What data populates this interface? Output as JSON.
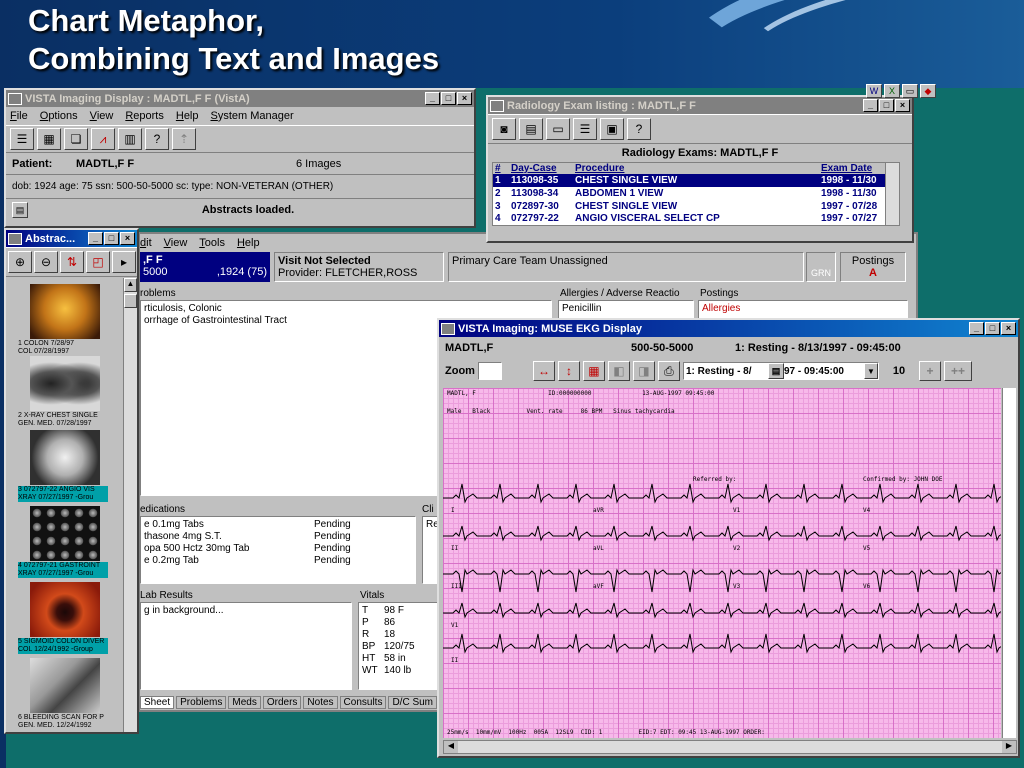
{
  "slide": {
    "title_line1": "Chart Metaphor,",
    "title_line2": "Combining Text and Images"
  },
  "vista_display": {
    "title": "VISTA Imaging Display : MADTL,F F (VistA)",
    "menu": [
      "File",
      "Options",
      "View",
      "Reports",
      "Help",
      "System Manager"
    ],
    "patient_label": "Patient:",
    "patient_name": "MADTL,F F",
    "image_count": "6 Images",
    "demographics": "dob: 1924   age: 75   ssn: 500-50-5000   sc:     type: NON-VETERAN (OTHER)",
    "status": "Abstracts loaded."
  },
  "radiology": {
    "title": "Radiology Exam listing  : MADTL,F F",
    "heading": "Radiology Exams: MADTL,F F",
    "columns": [
      "#",
      "Day-Case",
      "Procedure",
      "Exam Date"
    ],
    "rows": [
      {
        "n": "1",
        "case": "113098-35",
        "proc": "CHEST SINGLE VIEW",
        "date": "1998 - 11/30"
      },
      {
        "n": "2",
        "case": "113098-34",
        "proc": "ABDOMEN 1 VIEW",
        "date": "1998 - 11/30"
      },
      {
        "n": "3",
        "case": "072897-30",
        "proc": "CHEST SINGLE VIEW",
        "date": "1997 - 07/28"
      },
      {
        "n": "4",
        "case": "072797-22",
        "proc": "ANGIO VISCERAL SELECT CP",
        "date": "1997 - 07/27"
      }
    ]
  },
  "cprs": {
    "menu": [
      "dit",
      "View",
      "Tools",
      "Help"
    ],
    "patient_name": ",F F",
    "patient_id": "5000",
    "patient_dob": ",1924 (75)",
    "visit": "Visit Not Selected",
    "provider": "Provider:  FLETCHER,ROSS",
    "care_team": "Primary Care Team Unassigned",
    "grn_data": "GRN\nData",
    "postings_label": "Postings",
    "postings_flag": "A",
    "problems_label": "roblems",
    "problems": [
      "rticulosis, Colonic",
      "orrhage of Gastrointestinal Tract"
    ],
    "allergies_label": "Allergies / Adverse Reactio",
    "allergies": [
      "Penicillin"
    ],
    "postings_col_label": "Postings",
    "postings": [
      "Allergies"
    ],
    "meds_label": "edications",
    "meds": [
      {
        "name": "e 0.1mg Tabs",
        "status": "Pending"
      },
      {
        "name": "thasone 4mg S.T.",
        "status": "Pending"
      },
      {
        "name": "opa 500 Hctz 30mg Tab",
        "status": "Pending"
      },
      {
        "name": "e 0.2mg Tab",
        "status": "Pending"
      }
    ],
    "cli_label": "Cli",
    "cli_value": "Re",
    "labs_label": "Lab Results",
    "labs_value": "g in background...",
    "vitals_label": "Vitals",
    "vitals": [
      {
        "k": "T",
        "v": "98 F"
      },
      {
        "k": "P",
        "v": "86"
      },
      {
        "k": "R",
        "v": "18"
      },
      {
        "k": "BP",
        "v": "120/75"
      },
      {
        "k": "HT",
        "v": "58 in"
      },
      {
        "k": "WT",
        "v": "140 lb"
      }
    ],
    "tabs": [
      "Sheet",
      "Problems",
      "Meds",
      "Orders",
      "Notes",
      "Consults",
      "D/C Sum"
    ]
  },
  "abstracts": {
    "title": "Abstrac...",
    "items": [
      {
        "cap": "1 COLON  7/28/97\nCOL  07/28/1997",
        "highlight": false,
        "color": "#b86a10"
      },
      {
        "cap": "2 X-RAY   CHEST SINGLE\nGEN. MED.  07/28/1997",
        "highlight": false,
        "color": "#8c8c8c"
      },
      {
        "cap": "3 072797-22  ANGIO VIS\nXRAY  07/27/1997 -Grou",
        "highlight": true,
        "color": "#6a6a6a"
      },
      {
        "cap": "4 072797-21  GASTROINT\nXRAY  07/27/1997 -Grou",
        "highlight": true,
        "color": "#303030"
      },
      {
        "cap": "5 SIGMOID COLON DIVER\nCOL  12/24/1992 -Group",
        "highlight": true,
        "color": "#b02010"
      },
      {
        "cap": "6 BLEEDING SCAN FOR P\nGEN. MED.  12/24/1992",
        "highlight": false,
        "color": "#707070"
      }
    ]
  },
  "ekg": {
    "title": "VISTA Imaging: MUSE EKG Display",
    "patient": "MADTL,F",
    "ssn": "500-50-5000",
    "study": "1: Resting - 8/13/1997 - 09:45:00",
    "zoom_label": "Zoom",
    "study_select": "1: Resting - 8/13/1997 - 09:45:00",
    "study_select_visible": "1: Resting - 8/",
    "study_select_tail": "97 - 09:45:00",
    "zoom_value": "10",
    "plus": "+",
    "plusplus": "++",
    "paper_header": "MADTL, F                    ID:000000000              13-AUG-1997 09:45:00",
    "paper_sub": "Male   Black          Vent. rate     86 BPM   Sinus tachycardia",
    "leads": [
      "I",
      "aVR",
      "V1",
      "V4",
      "II",
      "aVL",
      "V2",
      "V5",
      "III",
      "aVF",
      "V3",
      "V6",
      "V1",
      "II",
      "V5"
    ],
    "referred": "Referred by:",
    "confirmed": "Confirmed by: JOHN DOE",
    "footer": "25mm/s  10mm/mV  100Hz  005A  12SL9  CID: 1          EID:7 EDT: 09:45 13-AUG-1997 ORDER:"
  }
}
